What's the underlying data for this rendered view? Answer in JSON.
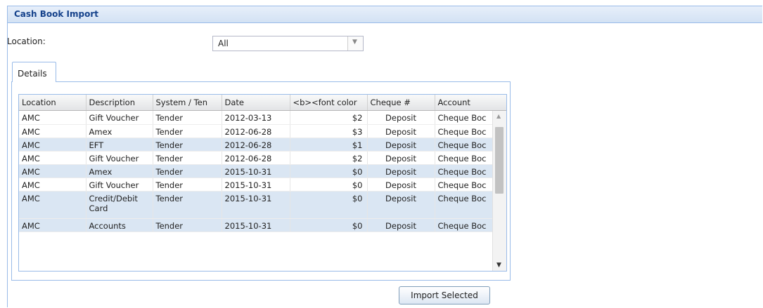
{
  "window": {
    "title": "Cash Book Import"
  },
  "location_filter": {
    "label": "Location:",
    "value": "All"
  },
  "tabs": [
    {
      "label": "Details"
    }
  ],
  "grid": {
    "columns": [
      "Location",
      "Description",
      "System / Ten",
      "Date",
      "<b><font color",
      "Cheque #",
      "Account"
    ],
    "rows": [
      [
        "AMC",
        "Gift Voucher",
        "Tender",
        "2012-03-13",
        "$2",
        "Deposit",
        "Cheque Boc"
      ],
      [
        "AMC",
        "Amex",
        "Tender",
        "2012-06-28",
        "$3",
        "Deposit",
        "Cheque Boc"
      ],
      [
        "AMC",
        "EFT",
        "Tender",
        "2012-06-28",
        "$1",
        "Deposit",
        "Cheque Boc"
      ],
      [
        "AMC",
        "Gift Voucher",
        "Tender",
        "2012-06-28",
        "$2",
        "Deposit",
        "Cheque Boc"
      ],
      [
        "AMC",
        "Amex",
        "Tender",
        "2015-10-31",
        "$0",
        "Deposit",
        "Cheque Boc"
      ],
      [
        "AMC",
        "Gift Voucher",
        "Tender",
        "2015-10-31",
        "$0",
        "Deposit",
        "Cheque Boc"
      ],
      [
        "AMC",
        "Credit/Debit Card",
        "Tender",
        "2015-10-31",
        "$0",
        "Deposit",
        "Cheque Boc"
      ],
      [
        "AMC",
        "Accounts",
        "Tender",
        "2015-10-31",
        "$0",
        "Deposit",
        "Cheque Boc"
      ]
    ]
  },
  "actions": {
    "import_label": "Import Selected"
  },
  "icons": {
    "combo_trigger": "chevron-down-icon",
    "scroll_up": "arrow-up-icon",
    "scroll_down": "arrow-down-icon"
  },
  "colors": {
    "header_text": "#15428b",
    "border": "#99bbe8",
    "alt_row": "#dae6f3"
  }
}
